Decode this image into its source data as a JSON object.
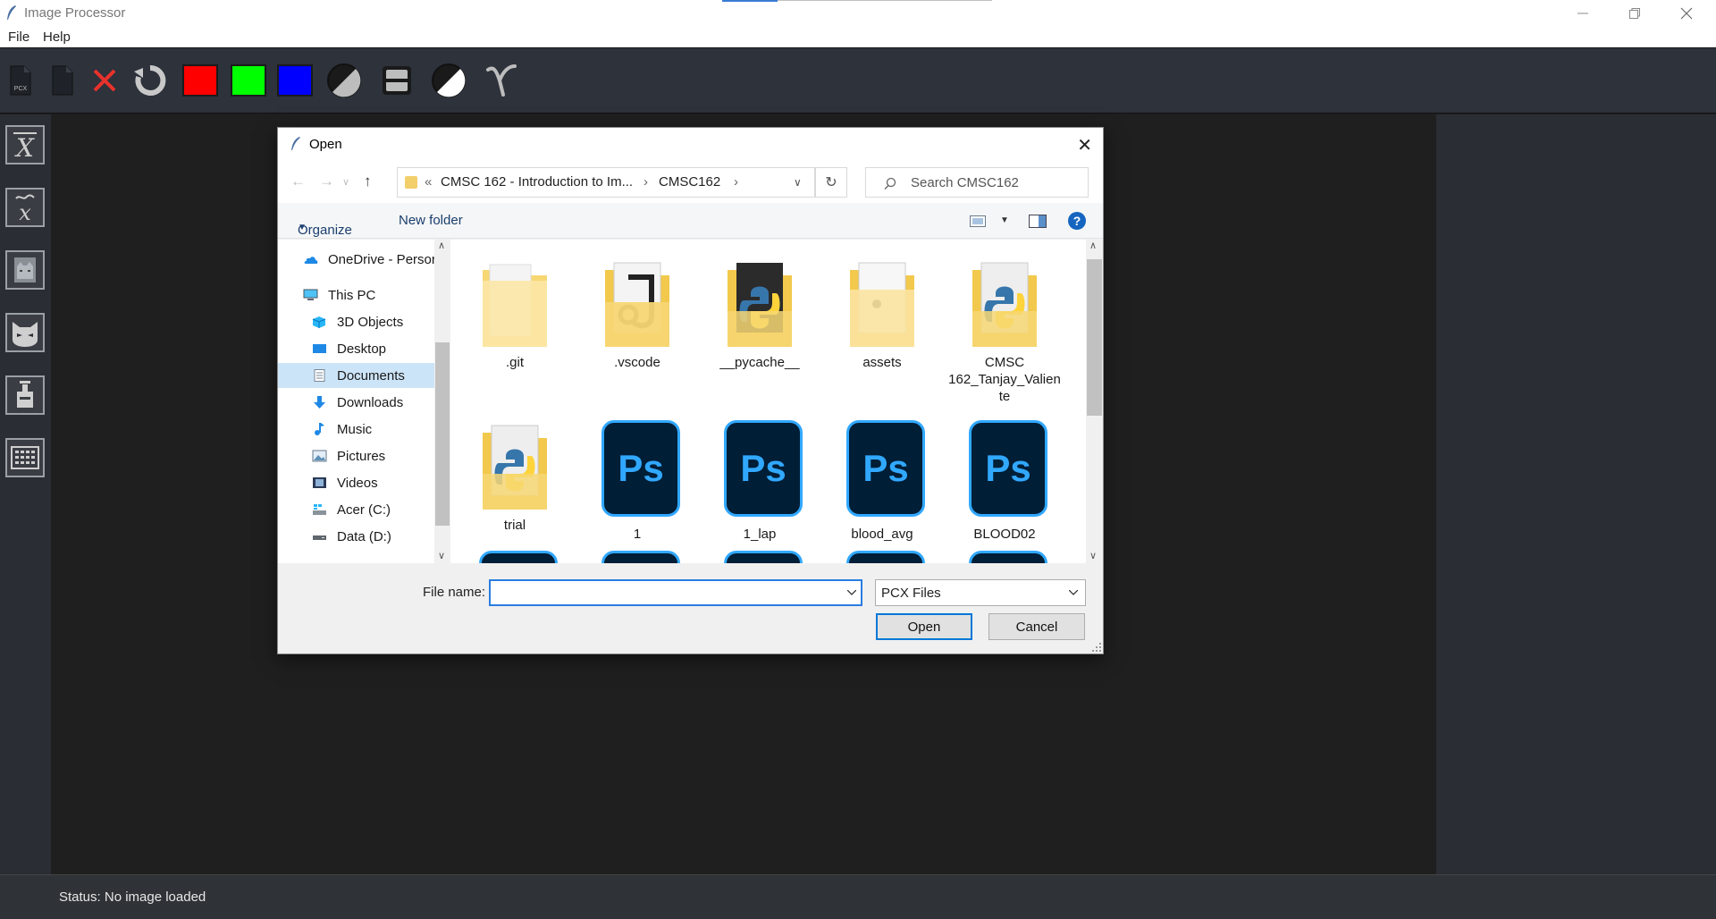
{
  "app": {
    "title": "Image Processor",
    "menu": [
      "File",
      "Help"
    ],
    "status": "Status: No image loaded",
    "toolbar_label_pcx": "PCX",
    "swatch_colors": {
      "red": "#ff0000",
      "green": "#00ff00",
      "blue": "#0000ff"
    }
  },
  "dialog": {
    "title": "Open",
    "breadcrumb": {
      "prefix": "«",
      "parent": "CMSC 162 - Introduction to Im...",
      "current": "CMSC162"
    },
    "search_placeholder": "Search CMSC162",
    "organize_label": "Organize",
    "new_folder_label": "New folder",
    "nav_items": [
      {
        "label": "OneDrive - Persor",
        "icon": "onedrive-icon"
      },
      {
        "label": "This PC",
        "icon": "pc-icon"
      },
      {
        "label": "3D Objects",
        "icon": "3d-objects-icon"
      },
      {
        "label": "Desktop",
        "icon": "desktop-icon"
      },
      {
        "label": "Documents",
        "icon": "documents-icon",
        "selected": true
      },
      {
        "label": "Downloads",
        "icon": "downloads-icon"
      },
      {
        "label": "Music",
        "icon": "music-icon"
      },
      {
        "label": "Pictures",
        "icon": "pictures-icon"
      },
      {
        "label": "Videos",
        "icon": "videos-icon"
      },
      {
        "label": "Acer (C:)",
        "icon": "drive-icon"
      },
      {
        "label": "Data (D:)",
        "icon": "drive-icon"
      }
    ],
    "files": [
      {
        "name": ".git",
        "kind": "folder"
      },
      {
        "name": ".vscode",
        "kind": "folder"
      },
      {
        "name": "__pycache__",
        "kind": "folder"
      },
      {
        "name": "assets",
        "kind": "folder"
      },
      {
        "name": "CMSC 162_Tanjay_Valiente",
        "line1": "CMSC",
        "line2": "162_Tanjay_Valien",
        "line3": "te",
        "kind": "folder"
      },
      {
        "name": "trial",
        "kind": "folder"
      },
      {
        "name": "1",
        "kind": "psd"
      },
      {
        "name": "1_lap",
        "kind": "psd"
      },
      {
        "name": "blood_avg",
        "kind": "psd"
      },
      {
        "name": "BLOOD02",
        "kind": "psd"
      }
    ],
    "ps_glyph": "Ps",
    "file_name_label": "File name:",
    "file_name_value": "",
    "file_type": "PCX Files",
    "open_label": "Open",
    "cancel_label": "Cancel"
  }
}
